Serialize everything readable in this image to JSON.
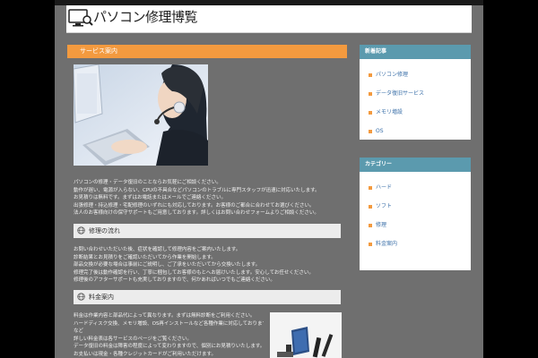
{
  "site": {
    "title": "パソコン修理博覧",
    "logo_icon": "computer-wrench-icon"
  },
  "main": {
    "section_title": "サービス案内",
    "intro_lines": [
      "パソコンの修理・データ復旧のことならお気軽にご相談ください。",
      "動作が遅い、電源が入らない、CPUの不具合などパソコンのトラブルに専門スタッフが迅速に対応いたします。",
      "お見積りは無料です。まずはお電話またはメールでご連絡ください。",
      "出張修理・持込修理・宅配修理のいずれにも対応しております。お客様のご都合に合わせてお選びください。",
      "法人のお客様向けの保守サポートもご用意しております。詳しくはお問い合わせフォームよりご相談ください。"
    ],
    "sections": [
      {
        "title": "修理の流れ",
        "icon": "globe-icon",
        "lines": [
          "お問い合わせいただいた後、症状を確認して修理内容をご案内いたします。",
          "診断結果とお見積りをご確認いただいてから作業を開始します。",
          "部品交換が必要な場合は事前にご説明し、ご了承をいただいてから交換いたします。",
          "修理完了後は動作確認を行い、丁寧に梱包してお客様のもとへお届けいたします。安心してお任せください。",
          "修理後のアフターサポートも充実しておりますので、何かあればいつでもご連絡ください。"
        ]
      },
      {
        "title": "料金案内",
        "icon": "globe-icon",
        "lines": [
          "料金は作業内容と部品代によって異なります。まずは無料診断をご利用ください。",
          "ハードディスク交換、メモリ増設、OS再インストールなど各種作業に対応しております。",
          "など",
          "詳しい料金表は各サービスのページをご覧ください。",
          "データ復旧の料金は障害の程度によって変わりますので、個別にお見積りいたします。",
          "お支払いは現金・各種クレジットカードがご利用いただけます。"
        ]
      }
    ]
  },
  "sidebar": {
    "recent": {
      "title": "新着記事",
      "items": [
        "パソコン修理",
        "データ復旧サービス",
        "メモリ増設",
        "OS"
      ]
    },
    "categories": {
      "title": "カテゴリー",
      "items": [
        "ハード",
        "ソフト",
        "修理",
        "料金案内"
      ]
    }
  },
  "colors": {
    "page_bg": "#000000",
    "content_bg": "#6f6f6f",
    "accent_orange": "#f39a3f",
    "sidebar_head": "#5b9aae",
    "link": "#3a6fa8"
  }
}
